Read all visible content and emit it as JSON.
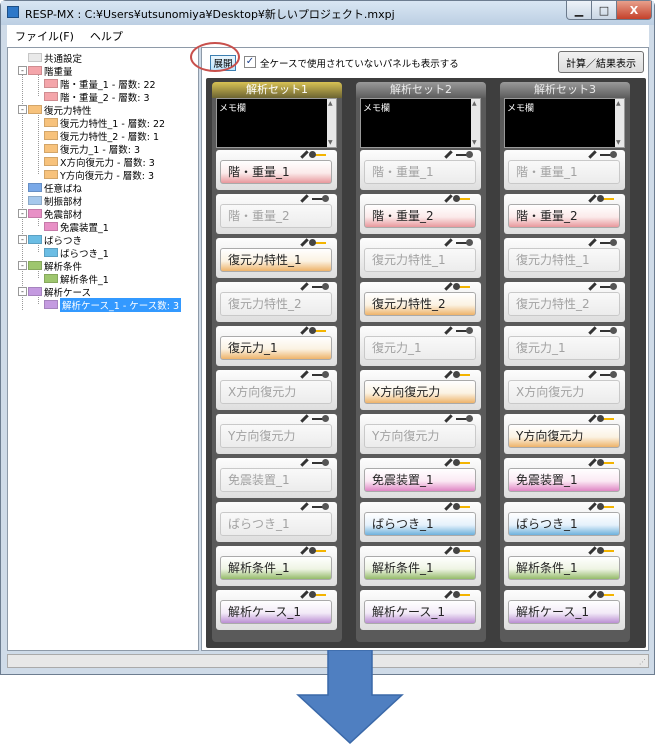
{
  "window": {
    "title": "RESP-MX : C:¥Users¥utsunomiya¥Desktop¥新しいプロジェクト.mxpj",
    "controls": {
      "min": "▁",
      "max": "□",
      "close": "X"
    }
  },
  "menu": [
    {
      "label": "ファイル(F)"
    },
    {
      "label": "ヘルプ"
    }
  ],
  "tree": [
    {
      "label": "共通設定",
      "color": "#e9e9e9"
    },
    {
      "label": "階重量",
      "color": "#f4a5aa"
    },
    {
      "label": "階・重量_1 - 層数: 22",
      "color": "#f4a5aa"
    },
    {
      "label": "階・重量_2 - 層数: 3",
      "color": "#f4a5aa"
    },
    {
      "label": "復元力特性",
      "color": "#f7c27c"
    },
    {
      "label": "復元力特性_1 - 層数: 22",
      "color": "#f7c27c"
    },
    {
      "label": "復元力特性_2 - 層数: 1",
      "color": "#f7c27c"
    },
    {
      "label": "復元力_1 - 層数: 3",
      "color": "#f7c27c"
    },
    {
      "label": "X方向復元力 - 層数: 3",
      "color": "#f7c27c"
    },
    {
      "label": "Y方向復元力 - 層数: 3",
      "color": "#f7c27c"
    },
    {
      "label": "任意ばね",
      "color": "#7aa9e8"
    },
    {
      "label": "制振部材",
      "color": "#a6c8ec"
    },
    {
      "label": "免震部材",
      "color": "#e890c6"
    },
    {
      "label": "免震装置_1",
      "color": "#e890c6"
    },
    {
      "label": "ばらつき",
      "color": "#6bbde4"
    },
    {
      "label": "ばらつき_1",
      "color": "#6bbde4"
    },
    {
      "label": "解析条件",
      "color": "#9ec66e"
    },
    {
      "label": "解析条件_1",
      "color": "#9ec66e"
    },
    {
      "label": "解析ケース",
      "color": "#c49ae0"
    },
    {
      "label": "解析ケース_1 - ケース数: 3",
      "color": "#c49ae0"
    }
  ],
  "toolbar": {
    "expand_label": "展開",
    "show_unused_label": "全ケースで使用されていないパネルも表示する",
    "show_unused_checked": "✓",
    "calc_label": "計算／結果表示"
  },
  "sets": [
    {
      "name": "解析セット1",
      "memo_label": "メモ欄",
      "active": true,
      "cards": [
        {
          "label": "階・重量_1",
          "on": true,
          "color": "red"
        },
        {
          "label": "階・重量_2",
          "on": false,
          "color": "red"
        },
        {
          "label": "復元力特性_1",
          "on": true,
          "color": "orange"
        },
        {
          "label": "復元力特性_2",
          "on": false,
          "color": "orange"
        },
        {
          "label": "復元力_1",
          "on": true,
          "color": "orange"
        },
        {
          "label": "X方向復元力",
          "on": false,
          "color": "orange"
        },
        {
          "label": "Y方向復元力",
          "on": false,
          "color": "orange"
        },
        {
          "label": "免震装置_1",
          "on": false,
          "color": "pink"
        },
        {
          "label": "ばらつき_1",
          "on": false,
          "color": "blue"
        },
        {
          "label": "解析条件_1",
          "on": true,
          "color": "green"
        },
        {
          "label": "解析ケース_1",
          "on": true,
          "color": "purple"
        }
      ]
    },
    {
      "name": "解析セット2",
      "memo_label": "メモ欄",
      "active": false,
      "cards": [
        {
          "label": "階・重量_1",
          "on": false,
          "color": "red"
        },
        {
          "label": "階・重量_2",
          "on": true,
          "color": "red"
        },
        {
          "label": "復元力特性_1",
          "on": false,
          "color": "orange"
        },
        {
          "label": "復元力特性_2",
          "on": true,
          "color": "orange"
        },
        {
          "label": "復元力_1",
          "on": false,
          "color": "orange"
        },
        {
          "label": "X方向復元力",
          "on": true,
          "color": "orange"
        },
        {
          "label": "Y方向復元力",
          "on": false,
          "color": "orange"
        },
        {
          "label": "免震装置_1",
          "on": true,
          "color": "pink"
        },
        {
          "label": "ばらつき_1",
          "on": true,
          "color": "blue"
        },
        {
          "label": "解析条件_1",
          "on": true,
          "color": "green"
        },
        {
          "label": "解析ケース_1",
          "on": true,
          "color": "purple"
        }
      ]
    },
    {
      "name": "解析セット3",
      "memo_label": "メモ欄",
      "active": false,
      "cards": [
        {
          "label": "階・重量_1",
          "on": false,
          "color": "red"
        },
        {
          "label": "階・重量_2",
          "on": true,
          "color": "red"
        },
        {
          "label": "復元力特性_1",
          "on": false,
          "color": "orange"
        },
        {
          "label": "復元力特性_2",
          "on": false,
          "color": "orange"
        },
        {
          "label": "復元力_1",
          "on": false,
          "color": "orange"
        },
        {
          "label": "X方向復元力",
          "on": false,
          "color": "orange"
        },
        {
          "label": "Y方向復元力",
          "on": true,
          "color": "orange"
        },
        {
          "label": "免震装置_1",
          "on": true,
          "color": "pink"
        },
        {
          "label": "ばらつき_1",
          "on": true,
          "color": "blue"
        },
        {
          "label": "解析条件_1",
          "on": true,
          "color": "green"
        },
        {
          "label": "解析ケース_1",
          "on": true,
          "color": "purple"
        }
      ]
    }
  ],
  "colors": {
    "arrow": "#4f7fc1",
    "highlight_circle": "#c8504c",
    "active_set_header": "#c9b44c"
  }
}
